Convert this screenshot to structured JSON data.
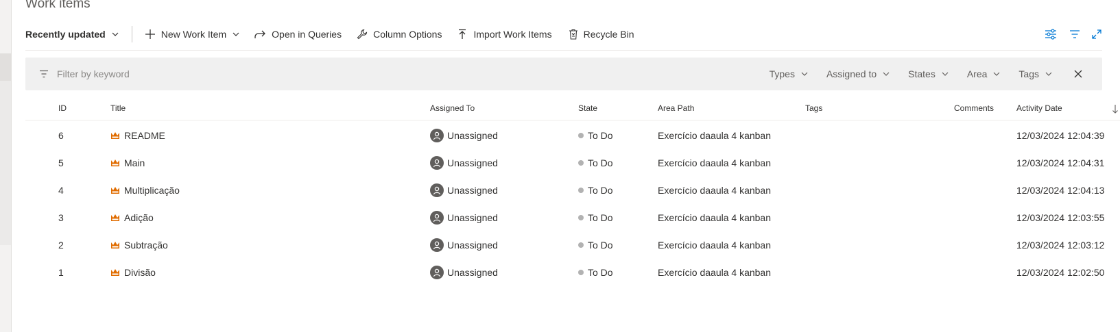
{
  "page": {
    "title": "Work items"
  },
  "toolbar": {
    "recently_updated": "Recently updated",
    "new_work_item": "New Work Item",
    "open_in_queries": "Open in Queries",
    "column_options": "Column Options",
    "import_work_items": "Import Work Items",
    "recycle_bin": "Recycle Bin"
  },
  "filter": {
    "placeholder": "Filter by keyword",
    "types": "Types",
    "assigned_to": "Assigned to",
    "states": "States",
    "area": "Area",
    "tags": "Tags"
  },
  "columns": {
    "id": "ID",
    "title": "Title",
    "assigned_to": "Assigned To",
    "state": "State",
    "area_path": "Area Path",
    "tags": "Tags",
    "comments": "Comments",
    "activity_date": "Activity Date"
  },
  "rows": [
    {
      "id": "6",
      "title": "README",
      "assigned": "Unassigned",
      "state": "To Do",
      "area": "Exercício daaula 4 kanban",
      "date": "12/03/2024 12:04:39"
    },
    {
      "id": "5",
      "title": "Main",
      "assigned": "Unassigned",
      "state": "To Do",
      "area": "Exercício daaula 4 kanban",
      "date": "12/03/2024 12:04:31"
    },
    {
      "id": "4",
      "title": "Multiplicação",
      "assigned": "Unassigned",
      "state": "To Do",
      "area": "Exercício daaula 4 kanban",
      "date": "12/03/2024 12:04:13"
    },
    {
      "id": "3",
      "title": "Adição",
      "assigned": "Unassigned",
      "state": "To Do",
      "area": "Exercício daaula 4 kanban",
      "date": "12/03/2024 12:03:55"
    },
    {
      "id": "2",
      "title": "Subtração",
      "assigned": "Unassigned",
      "state": "To Do",
      "area": "Exercício daaula 4 kanban",
      "date": "12/03/2024 12:03:12"
    },
    {
      "id": "1",
      "title": "Divisão",
      "assigned": "Unassigned",
      "state": "To Do",
      "area": "Exercício daaula 4 kanban",
      "date": "12/03/2024 12:02:50"
    }
  ],
  "icons": {
    "work_item_type": "crown-icon",
    "avatar": "unassigned-avatar-icon"
  },
  "colors": {
    "accent": "#0078d4",
    "work_item_type": "#e06c00",
    "state_todo": "#b2b2b2"
  }
}
